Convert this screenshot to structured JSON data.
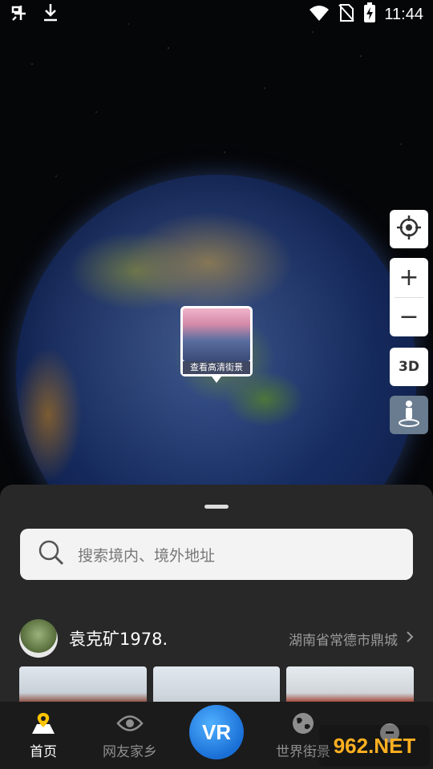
{
  "status_bar": {
    "left_icons": [
      "bug-icon",
      "download-icon"
    ],
    "right_icons": [
      "wifi-icon",
      "no-sim-icon",
      "battery-charging-icon"
    ],
    "time": "11:44"
  },
  "map": {
    "street_view_marker": {
      "caption": "查看高清街景"
    },
    "controls": {
      "three_d_label": "3D",
      "zoom_in": "+",
      "zoom_out": "−"
    }
  },
  "sheet": {
    "search_placeholder": "搜索境内、境外地址",
    "user": {
      "name": "袁克矿1978.",
      "location": "湖南省常德市鼎城"
    }
  },
  "tabs": [
    {
      "label": "首页",
      "icon": "map-pin-icon",
      "active": true
    },
    {
      "label": "网友家乡",
      "icon": "eye-icon",
      "active": false
    },
    {
      "label": "VR",
      "icon": "vr-icon",
      "active": false
    },
    {
      "label": "世界街景",
      "icon": "globe-icon",
      "active": false
    },
    {
      "label": "",
      "icon": "profile-icon",
      "active": false
    }
  ],
  "watermark": "962.NET",
  "colors": {
    "sheet_bg": "#282828",
    "tabbar_bg": "#1b1b1b",
    "vr_accent": "#1a6fd6"
  }
}
